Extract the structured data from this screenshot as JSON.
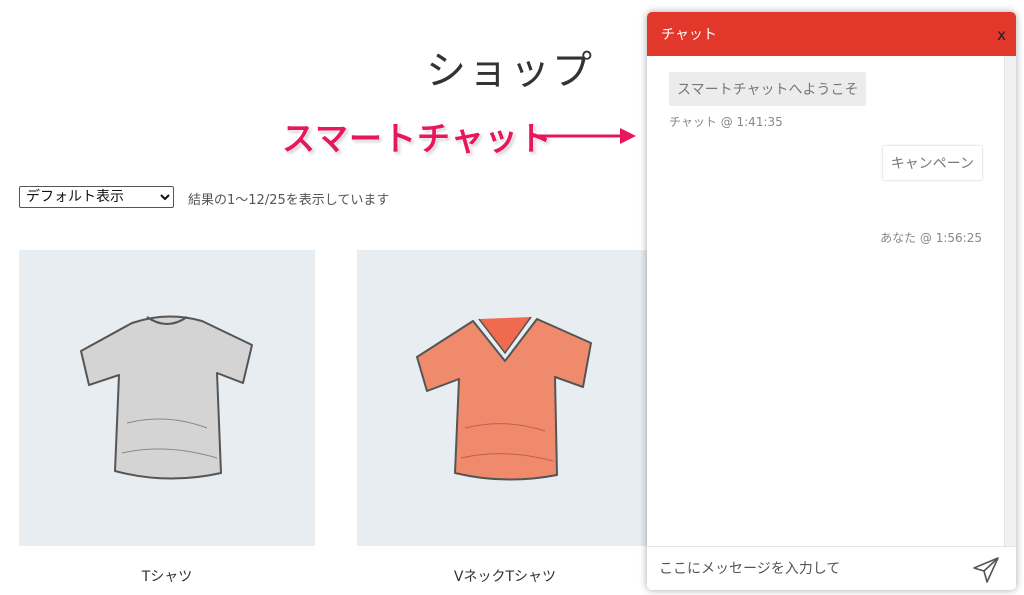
{
  "shop": {
    "title": "ショップ",
    "sort_selected": "デフォルト表示",
    "result_count": "結果の1〜12/25を表示しています"
  },
  "annotation": {
    "text": "スマートチャット",
    "color": "#e8175d"
  },
  "products": [
    {
      "name": "Tシャツ",
      "image": "tshirt-gray-icon",
      "color": "#d0d0d0"
    },
    {
      "name": "VネックTシャツ",
      "image": "vneck-tshirt-orange-icon",
      "color": "#f08060"
    }
  ],
  "chat": {
    "header_title": "チャット",
    "close_label": "x",
    "header_color": "#e2382c",
    "messages": [
      {
        "from": "bot",
        "text": "スマートチャットへようこそ",
        "meta": "チャット @ 1:41:35"
      },
      {
        "from": "user",
        "text": "キャンペーン",
        "meta": "あなた @ 1:56:25"
      }
    ],
    "input_placeholder": "ここにメッセージを入力して",
    "send_icon": "send-icon"
  }
}
